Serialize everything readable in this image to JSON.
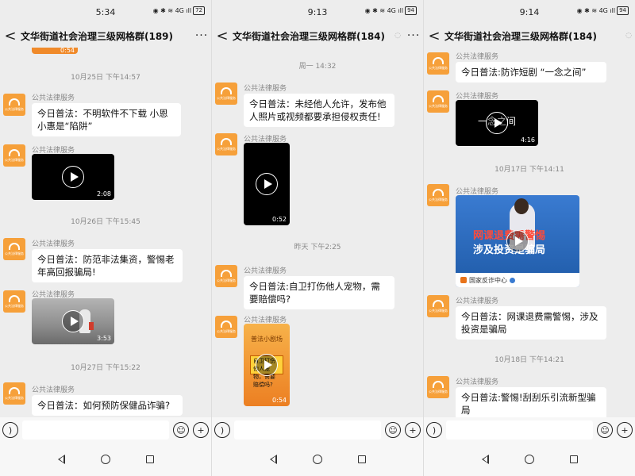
{
  "panels": [
    {
      "status": {
        "time": "5:34",
        "icons": "◉ ✱ ≋ 4G ıll",
        "battery": "72"
      },
      "header": {
        "back": "<",
        "title": "文华街道社会治理三级网格群(189)",
        "more": "···"
      },
      "messages": {
        "top_video_duration": "0:54",
        "ts1": "10月25日 下午14:57",
        "sender1": "公共法律服务",
        "text1": "今日普法：不明软件不下载 小恩小惠是“陷阱”",
        "sender2": "公共法律服务",
        "video2_duration": "2:08",
        "ts2": "10月26日 下午15:45",
        "sender3": "公共法律服务",
        "text3": "今日普法：防范非法集资，警惕老年高回报骗局!",
        "sender4": "公共法律服务",
        "video4_duration": "3:53",
        "ts3": "10月27日 下午15:22",
        "sender5": "公共法律服务",
        "text5": "今日普法：如何预防保健品诈骗?"
      },
      "avatar_label": "公共法律服务"
    },
    {
      "status": {
        "time": "9:13",
        "icons": "◉ ✱ ≋ 4G ıll",
        "battery": "94"
      },
      "header": {
        "back": "<",
        "title": "文华街道社会治理三级网格群(184)",
        "more": "···"
      },
      "messages": {
        "ts1": "周一 14:32",
        "sender1": "公共法律服务",
        "text1": "今日普法：未经他人允许，发布他人照片或视频都要承担侵权责任!",
        "sender2": "公共法律服务",
        "video2_duration": "0:52",
        "ts2": "昨天 下午2:25",
        "sender3": "公共法律服务",
        "text3": "今日普法:自卫打伤他人宠物，需要赔偿吗?",
        "sender4": "公共法律服务",
        "video4_title": "普法小剧场",
        "video4_box": "自卫打伤他人宠物，需要赔偿吗?",
        "video4_duration": "0:54"
      },
      "avatar_label": "公共法律服务"
    },
    {
      "status": {
        "time": "9:14",
        "icons": "◉ ✱ ≋ 4G ıll",
        "battery": "94"
      },
      "header": {
        "back": "<",
        "title": "文华街道社会治理三级网格群(184)",
        "more": "···"
      },
      "messages": {
        "sender1": "公共法律服务",
        "text1": "今日普法:防诈短剧 “一念之间”",
        "sender2": "公共法律服务",
        "video2_title": "一念之间",
        "video2_duration": "4:16",
        "ts1": "10月17日 下午14:11",
        "sender3": "公共法律服务",
        "video3_line1": "网课退费需警惕",
        "video3_line2": "涉及投资是骗局",
        "video3_channel": "国家反诈中心",
        "sender4": "公共法律服务",
        "text4": "今日普法：网课退费需警惕，涉及投资是骗局",
        "ts2": "10月18日 下午14:21",
        "sender5": "公共法律服务",
        "text5": "今日普法:警惕!刮刮乐引流新型骗局"
      },
      "avatar_label": "公共法律服务"
    }
  ],
  "colors": {
    "chat_bg": "#ededed",
    "avatar": "#f6a03a",
    "bubble": "#ffffff"
  },
  "icons": {
    "voice": "voice-icon",
    "emoji": "emoji-icon",
    "plus": "plus-icon"
  }
}
